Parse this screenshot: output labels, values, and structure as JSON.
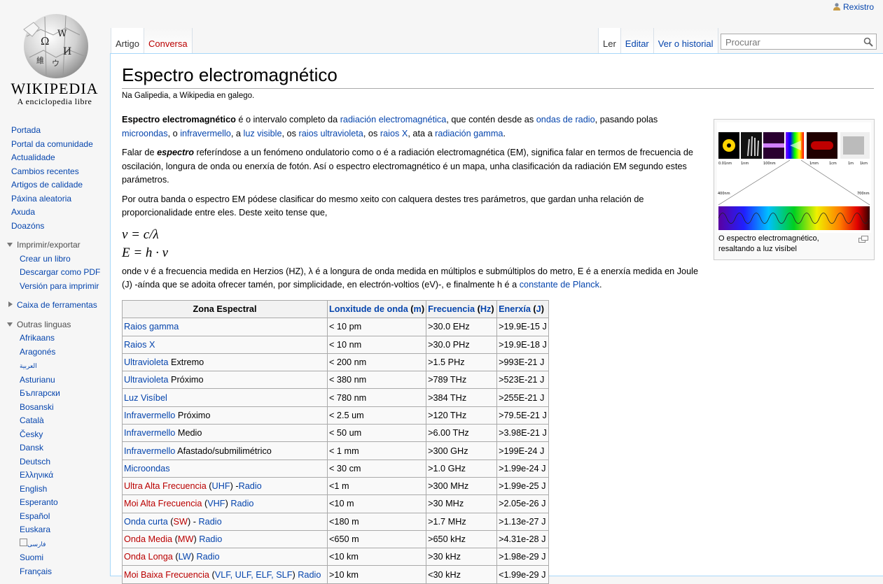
{
  "logo": {
    "wordmark": "WIKIPEDIA",
    "tagline": "A enciclopedia libre"
  },
  "personal": {
    "register": "Rexistro"
  },
  "tabs": {
    "article": "Artigo",
    "talk": "Conversa",
    "read": "Ler",
    "edit": "Editar",
    "history": "Ver o historial"
  },
  "search": {
    "placeholder": "Procurar"
  },
  "sidebar": {
    "nav": [
      "Portada",
      "Portal da comunidade",
      "Actualidade",
      "Cambios recentes",
      "Artigos de calidade",
      "Páxina aleatoria",
      "Axuda",
      "Doazóns"
    ],
    "print_header": "Imprimir/exportar",
    "print_items": [
      "Crear un libro",
      "Descargar como PDF",
      "Versión para imprimir"
    ],
    "tools_header": "Caixa de ferramentas",
    "lang_header": "Outras linguas",
    "languages": [
      "Afrikaans",
      "Aragonés",
      "العربية",
      "Asturianu",
      "Български",
      "Bosanski",
      "Català",
      "Česky",
      "Dansk",
      "Deutsch",
      "Ελληνικά",
      "English",
      "Esperanto",
      "Español",
      "Euskara",
      "فارسی",
      "Suomi",
      "Français"
    ]
  },
  "page": {
    "title": "Espectro electromagnético",
    "sitesub": "Na Galipedia, a Wikipedia en galego.",
    "p1": {
      "bold": "Espectro electromagnético",
      "t1": " é o intervalo completo da ",
      "l1": "radiación electromagnética",
      "t2": ", que contén desde as ",
      "l2": "ondas de radio",
      "t3": ", pasando polas ",
      "l3": "microondas",
      "t4": ", o ",
      "l4": "infravermello",
      "t5": ", a ",
      "l5": "luz visible",
      "t6": ", os ",
      "l6": "raios ultravioleta",
      "t7": ", os ",
      "l7": "raios X",
      "t8": ", ata a ",
      "l8": "radiación gamma",
      "t9": "."
    },
    "p2": {
      "t1": "Falar de ",
      "em": "espectro",
      "t2": " referíndose a un fenómeno ondulatorio como o é a radiación electromagnética (EM), significa falar en termos de frecuencia de oscilación, longura de onda ou enerxía de fotón. Así o espectro electromagnético é un mapa, unha clasificación da radiación EM segundo estes parámetros."
    },
    "p3": "Por outra banda o espectro EM pódese clasificar do mesmo xeito con calquera destes tres parámetros, que gardan unha relación de proporcionalidade entre eles. Deste xeito tense que,",
    "eq1": "ν = c/λ",
    "eq2": "E = h · ν",
    "p4": {
      "t1": "onde ν é a frecuencia medida en Herzios (HZ), λ é a longura de onda medida en múltiplos e submúltiplos do metro, E é a enerxía medida en Joule (J) -aínda que se adoita ofrecer tamén, por simplicidade, en electrón-voltios (eV)-, e finalmente h é a ",
      "link": "constante de Planck",
      "t2": "."
    },
    "thumb": {
      "caption": "O espectro electromagnético, resaltando a luz visíbel",
      "scale_labels": [
        "0.01nm",
        "1nm",
        "100nm",
        "1mm",
        "1cm",
        "1m",
        "1km"
      ],
      "zoom_labels": [
        "400nm",
        "700nm"
      ]
    },
    "table": {
      "headers": {
        "zone": "Zona Espectral",
        "wl": "Lonxitude de onda",
        "wl_unit": "m",
        "freq": "Frecuencia",
        "freq_unit": "Hz",
        "energy": "Enerxía",
        "energy_unit": "J"
      },
      "rows": [
        {
          "zone": [
            {
              "t": "Raios gamma",
              "c": "link"
            }
          ],
          "wl": "< 10 pm",
          "freq": ">30.0 EHz",
          "energy": ">19.9E-15 J"
        },
        {
          "zone": [
            {
              "t": "Raios X",
              "c": "link"
            }
          ],
          "wl": "< 10 nm",
          "freq": ">30.0 PHz",
          "energy": ">19.9E-18 J"
        },
        {
          "zone": [
            {
              "t": "Ultravioleta",
              "c": "link"
            },
            {
              "t": " Extremo",
              "c": ""
            }
          ],
          "wl": "< 200 nm",
          "freq": ">1.5 PHz",
          "energy": ">993E-21 J"
        },
        {
          "zone": [
            {
              "t": "Ultravioleta",
              "c": "link"
            },
            {
              "t": " Próximo",
              "c": ""
            }
          ],
          "wl": "< 380 nm",
          "freq": ">789 THz",
          "energy": ">523E-21 J"
        },
        {
          "zone": [
            {
              "t": "Luz Visíbel",
              "c": "link"
            }
          ],
          "wl": "< 780 nm",
          "freq": ">384 THz",
          "energy": ">255E-21 J"
        },
        {
          "zone": [
            {
              "t": "Infravermello",
              "c": "link"
            },
            {
              "t": " Próximo",
              "c": ""
            }
          ],
          "wl": "< 2.5 um",
          "freq": ">120 THz",
          "energy": ">79.5E-21 J"
        },
        {
          "zone": [
            {
              "t": "Infravermello",
              "c": "link"
            },
            {
              "t": " Medio",
              "c": ""
            }
          ],
          "wl": "< 50 um",
          "freq": ">6.00 THz",
          "energy": ">3.98E-21 J"
        },
        {
          "zone": [
            {
              "t": "Infravermello",
              "c": "link"
            },
            {
              "t": " Afastado/submilimétrico",
              "c": ""
            }
          ],
          "wl": "< 1 mm",
          "freq": ">300 GHz",
          "energy": ">199E-24 J"
        },
        {
          "zone": [
            {
              "t": "Microondas",
              "c": "link"
            }
          ],
          "wl": "< 30 cm",
          "freq": ">1.0 GHz",
          "energy": ">1.99e-24 J"
        },
        {
          "zone": [
            {
              "t": "Ultra Alta Frecuencia",
              "c": "red"
            },
            {
              "t": " (",
              "c": ""
            },
            {
              "t": "UHF",
              "c": "link"
            },
            {
              "t": ") -",
              "c": ""
            },
            {
              "t": "Radio",
              "c": "link"
            }
          ],
          "wl": "<1 m",
          "freq": ">300 MHz",
          "energy": ">1.99e-25 J"
        },
        {
          "zone": [
            {
              "t": "Moi Alta Frecuencia",
              "c": "red"
            },
            {
              "t": " (",
              "c": ""
            },
            {
              "t": "VHF",
              "c": "link"
            },
            {
              "t": ") ",
              "c": ""
            },
            {
              "t": "Radio",
              "c": "link"
            }
          ],
          "wl": "<10 m",
          "freq": ">30 MHz",
          "energy": ">2.05e-26 J"
        },
        {
          "zone": [
            {
              "t": "Onda curta",
              "c": "link"
            },
            {
              "t": " (",
              "c": ""
            },
            {
              "t": "SW",
              "c": "red"
            },
            {
              "t": ") - ",
              "c": ""
            },
            {
              "t": "Radio",
              "c": "link"
            }
          ],
          "wl": "<180 m",
          "freq": ">1.7 MHz",
          "energy": ">1.13e-27 J"
        },
        {
          "zone": [
            {
              "t": "Onda Media",
              "c": "red"
            },
            {
              "t": " (",
              "c": ""
            },
            {
              "t": "MW",
              "c": "red"
            },
            {
              "t": ") ",
              "c": ""
            },
            {
              "t": "Radio",
              "c": "link"
            }
          ],
          "wl": "<650 m",
          "freq": ">650 kHz",
          "energy": ">4.31e-28 J"
        },
        {
          "zone": [
            {
              "t": "Onda Longa",
              "c": "red"
            },
            {
              "t": " (",
              "c": ""
            },
            {
              "t": "LW",
              "c": "link"
            },
            {
              "t": ") ",
              "c": ""
            },
            {
              "t": "Radio",
              "c": "link"
            }
          ],
          "wl": "<10 km",
          "freq": ">30 kHz",
          "energy": ">1.98e-29 J"
        },
        {
          "zone": [
            {
              "t": "Moi Baixa Frecuencia",
              "c": "red"
            },
            {
              "t": " (",
              "c": ""
            },
            {
              "t": "VLF, ULF, ELF, SLF",
              "c": "link"
            },
            {
              "t": ") ",
              "c": ""
            },
            {
              "t": "Radio",
              "c": "link"
            }
          ],
          "wl": ">10 km",
          "freq": "<30 kHz",
          "energy": "<1.99e-29 J"
        }
      ]
    }
  }
}
